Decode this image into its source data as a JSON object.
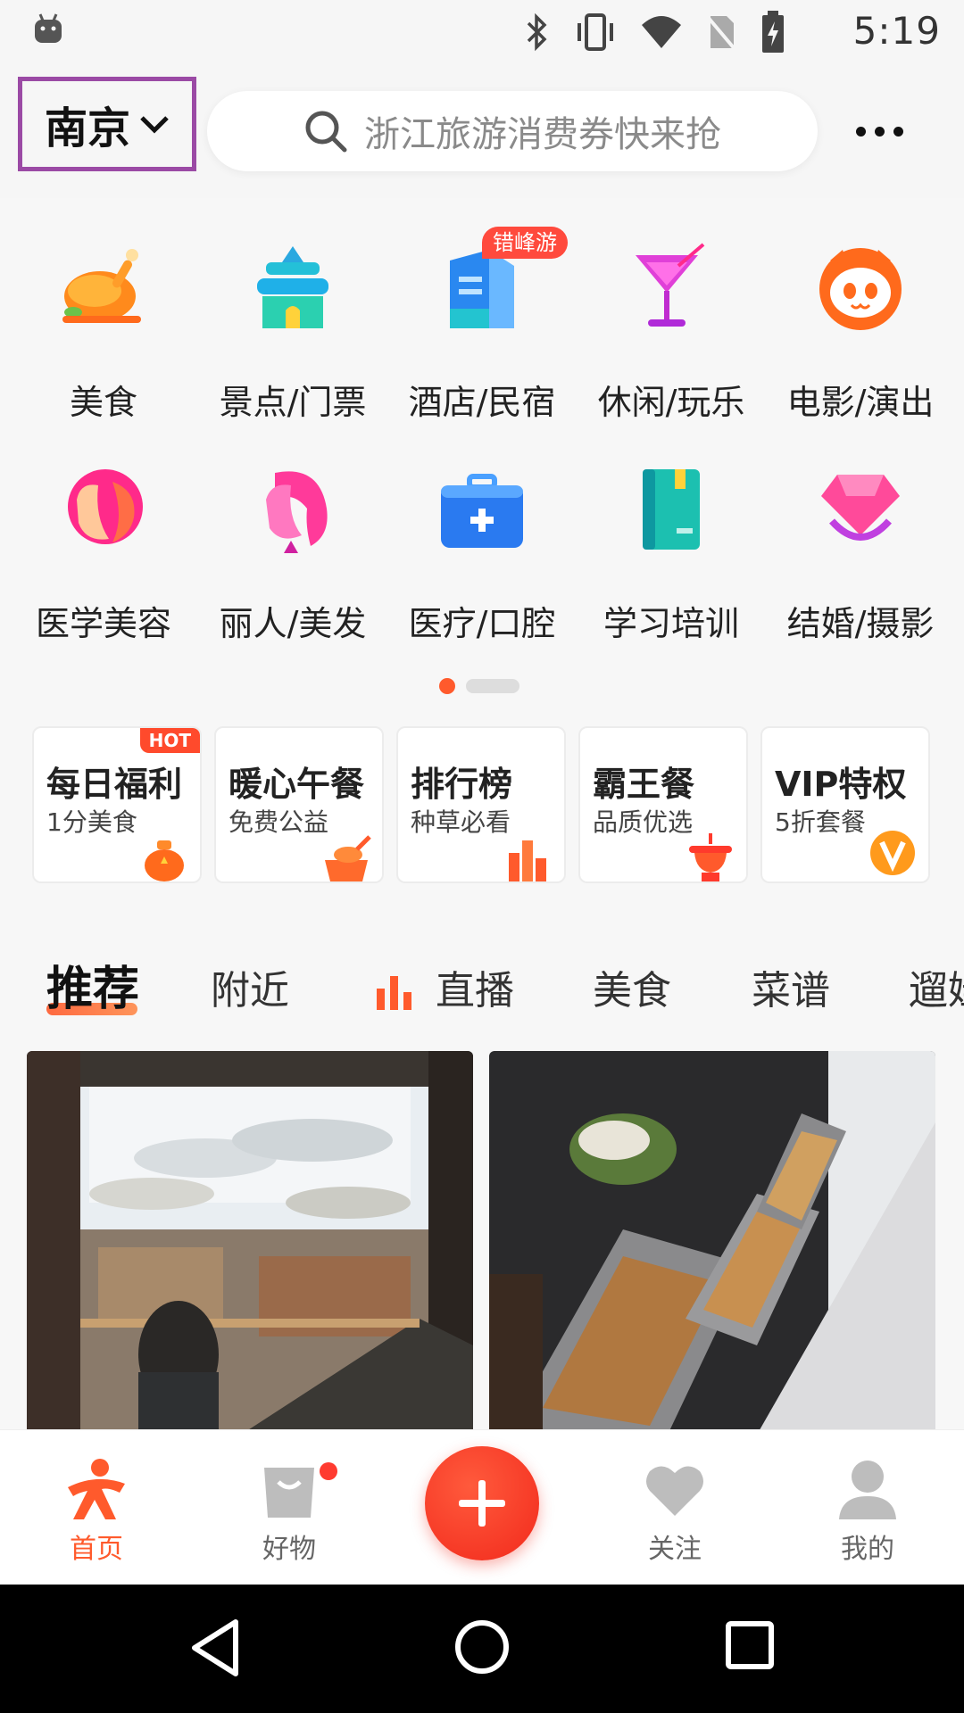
{
  "status_bar": {
    "time": "5:19",
    "icons": [
      "android-icon",
      "bluetooth-icon",
      "vibrate-icon",
      "wifi-icon",
      "no-sim-icon",
      "battery-charging-icon"
    ]
  },
  "header": {
    "city": "南京",
    "search_placeholder": "浙江旅游消费券快来抢"
  },
  "categories": [
    {
      "label": "美食",
      "icon": "roast-chicken-icon"
    },
    {
      "label": "景点/门票",
      "icon": "temple-icon"
    },
    {
      "label": "酒店/民宿",
      "icon": "hotel-building-icon",
      "badge": "错峰游"
    },
    {
      "label": "休闲/玩乐",
      "icon": "cocktail-icon"
    },
    {
      "label": "电影/演出",
      "icon": "cat-face-icon"
    },
    {
      "label": "医学美容",
      "icon": "beauty-face-icon"
    },
    {
      "label": "丽人/美发",
      "icon": "hairstyle-icon"
    },
    {
      "label": "医疗/口腔",
      "icon": "medical-kit-icon"
    },
    {
      "label": "学习培训",
      "icon": "book-icon"
    },
    {
      "label": "结婚/摄影",
      "icon": "diamond-ring-icon"
    }
  ],
  "promos": [
    {
      "title": "每日福利",
      "subtitle": "1分美食",
      "icon": "money-bag-icon",
      "badge": "HOT"
    },
    {
      "title": "暖心午餐",
      "subtitle": "免费公益",
      "icon": "meal-icon"
    },
    {
      "title": "排行榜",
      "subtitle": "种草必看",
      "icon": "bar-chart-icon"
    },
    {
      "title": "霸王餐",
      "subtitle": "品质优选",
      "icon": "hotpot-icon"
    },
    {
      "title": "VIP特权",
      "subtitle": "5折套餐",
      "icon": "vip-v-icon"
    }
  ],
  "feed_tabs": [
    {
      "label": "推荐",
      "active": true
    },
    {
      "label": "附近"
    },
    {
      "label": "直播",
      "icon": "live-bars-icon"
    },
    {
      "label": "美食"
    },
    {
      "label": "菜谱"
    },
    {
      "label": "遛娃"
    }
  ],
  "feed_cards": [
    {
      "image": "ancient-town-umbrellas-photo"
    },
    {
      "image": "buffet-food-trays-photo"
    }
  ],
  "bottom_nav": [
    {
      "label": "首页",
      "icon": "home-person-icon",
      "active": true
    },
    {
      "label": "好物",
      "icon": "shopping-bag-icon",
      "dot": true
    },
    {
      "label": "",
      "icon": "plus-icon"
    },
    {
      "label": "关注",
      "icon": "heart-icon"
    },
    {
      "label": "我的",
      "icon": "user-icon"
    }
  ],
  "colors": {
    "accent": "#ff5a2c",
    "highlight_border": "#9b4aa5"
  }
}
